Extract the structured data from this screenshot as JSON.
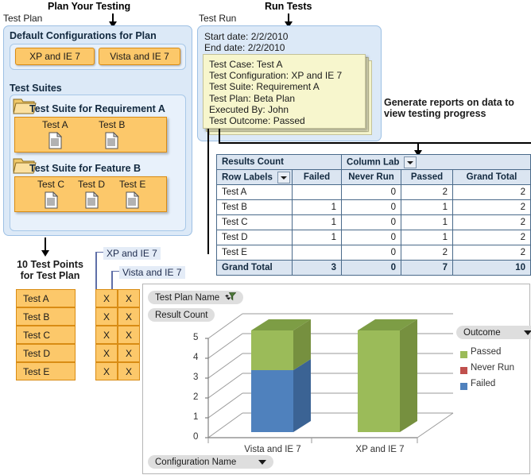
{
  "headings": {
    "plan_your_testing": "Plan Your Testing",
    "run_tests": "Run Tests",
    "generate_reports": "Generate reports on data to view testing progress"
  },
  "test_plan": {
    "label": "Test Plan",
    "default_configs": {
      "title": "Default Configurations for Plan",
      "items": [
        {
          "label": "XP and IE 7"
        },
        {
          "label": "Vista and IE 7"
        }
      ]
    },
    "test_suites": {
      "label": "Test Suites",
      "suites": [
        {
          "title": "Test Suite for Requirement A",
          "icon": "folder-icon",
          "tests": [
            {
              "label": "Test A",
              "icon": "document-icon"
            },
            {
              "label": "Test B",
              "icon": "document-icon"
            }
          ]
        },
        {
          "title": "Test Suite for Feature B",
          "icon": "folder-icon",
          "tests": [
            {
              "label": "Test C",
              "icon": "document-icon"
            },
            {
              "label": "Test D",
              "icon": "document-icon"
            },
            {
              "label": "Test E",
              "icon": "document-icon"
            }
          ]
        }
      ]
    }
  },
  "test_points": {
    "title_line1": "10 Test Points",
    "title_line2": "for Test Plan",
    "column_callouts": [
      {
        "label": "XP and IE 7"
      },
      {
        "label": "Vista and IE 7"
      }
    ],
    "rows": [
      {
        "name": "Test A",
        "col1": "X",
        "col2": "X"
      },
      {
        "name": "Test B",
        "col1": "X",
        "col2": "X"
      },
      {
        "name": "Test C",
        "col1": "X",
        "col2": "X"
      },
      {
        "name": "Test D",
        "col1": "X",
        "col2": "X"
      },
      {
        "name": "Test E",
        "col1": "X",
        "col2": "X"
      }
    ]
  },
  "test_run": {
    "label": "Test Run",
    "start_date": "Start date: 2/2/2010",
    "end_date": "End date: 2/2/2010",
    "result_note": [
      "Test Case: Test A",
      "Test Configuration: XP and IE 7",
      "Test Suite: Requirement A",
      "Test Plan: Beta Plan",
      "Executed By: John",
      "Test Outcome: Passed"
    ]
  },
  "pivot_table": {
    "corner_label": "Results Count",
    "column_label": "Column Lab",
    "row_label_header": "Row Labels",
    "columns": [
      "Failed",
      "Never Run",
      "Passed",
      "Grand Total"
    ],
    "rows": [
      {
        "label": "Test A",
        "values": [
          "",
          "0",
          "2",
          "2"
        ]
      },
      {
        "label": "Test B",
        "values": [
          "1",
          "0",
          "1",
          "2"
        ]
      },
      {
        "label": "Test C",
        "values": [
          "1",
          "0",
          "1",
          "2"
        ]
      },
      {
        "label": "Test D",
        "values": [
          "1",
          "0",
          "1",
          "2"
        ]
      },
      {
        "label": "Test E",
        "values": [
          "",
          "0",
          "2",
          "2"
        ]
      }
    ],
    "total_row": {
      "label": "Grand Total",
      "values": [
        "3",
        "0",
        "7",
        "10"
      ]
    }
  },
  "chart_data": {
    "type": "bar",
    "stacked": true,
    "three_d": true,
    "title": "",
    "value_field_label": "Result Count",
    "filter_field_label": "Test Plan Name",
    "xlabel": "Configuration Name",
    "ylabel": "",
    "categories": [
      "Vista and IE 7",
      "XP and IE 7"
    ],
    "series": [
      {
        "name": "Passed",
        "color": "#9bbb59",
        "values": [
          2,
          5
        ]
      },
      {
        "name": "Never Run",
        "color": "#c0504d",
        "values": [
          0,
          0
        ]
      },
      {
        "name": "Failed",
        "color": "#4f81bd",
        "values": [
          3,
          0
        ]
      }
    ],
    "ylim": [
      0,
      5
    ],
    "yticks": [
      "0",
      "1",
      "2",
      "3",
      "4",
      "5"
    ],
    "grid": true,
    "legend_title": "Outcome",
    "legend_position": "right"
  },
  "colors": {
    "orange_fill": "#fcc86a",
    "orange_border": "#d98c14",
    "panel_blue": "#dce9f7",
    "panel_blue_border": "#9dc0e4",
    "note_yellow": "#f7f6cd",
    "passed_green": "#9bbb59",
    "never_run_red": "#c0504d",
    "failed_blue": "#4f81bd",
    "table_header_blue": "#dbe5f1"
  }
}
